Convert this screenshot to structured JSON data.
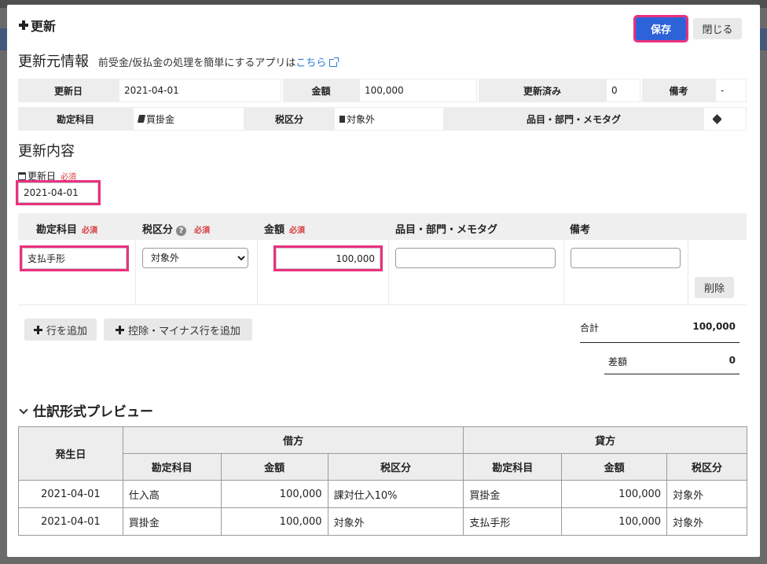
{
  "modal": {
    "title": "更新"
  },
  "header": {
    "save_label": "保存",
    "close_label": "閉じる"
  },
  "source_info": {
    "heading": "更新元情報",
    "note": "前受金/仮払金の処理を簡単にするアプリは",
    "link_label": "こちら",
    "row1": {
      "date_label": "更新日",
      "date_value": "2021-04-01",
      "amount_label": "金額",
      "amount_value": "100,000",
      "updated_label": "更新済み",
      "updated_value": "0",
      "remarks_label": "備考",
      "remarks_value": "-"
    },
    "row2": {
      "account_label": "勘定科目",
      "account_value": "買掛金",
      "tax_label": "税区分",
      "tax_value": "対象外",
      "tags_label": "品目・部門・メモタグ"
    }
  },
  "update_content": {
    "heading": "更新内容",
    "date_label": "更新日",
    "required": "必須",
    "date_value": "2021-04-01",
    "columns": {
      "account": "勘定科目",
      "tax": "税区分",
      "amount": "金額",
      "tags": "品目・部門・メモタグ",
      "remarks": "備考"
    },
    "help_icon": "?",
    "row": {
      "account": "支払手形",
      "tax_selected": "対象外",
      "amount": "100,000",
      "tags": "",
      "remarks": "",
      "delete_label": "削除"
    },
    "add_row_label": "行を追加",
    "add_minus_row_label": "控除・マイナス行を追加",
    "total_label": "合計",
    "total_value": "100,000",
    "diff_label": "差額",
    "diff_value": "0"
  },
  "preview": {
    "heading": "仕訳形式プレビュー",
    "date_header": "発生日",
    "debit_header": "借方",
    "credit_header": "貸方",
    "sub_headers": {
      "account": "勘定科目",
      "amount": "金額",
      "tax": "税区分"
    },
    "rows": [
      {
        "date": "2021-04-01",
        "debit_account": "仕入高",
        "debit_amount": "100,000",
        "debit_tax": "課対仕入10%",
        "credit_account": "買掛金",
        "credit_amount": "100,000",
        "credit_tax": "対象外"
      },
      {
        "date": "2021-04-01",
        "debit_account": "買掛金",
        "debit_amount": "100,000",
        "debit_tax": "対象外",
        "credit_account": "支払手形",
        "credit_amount": "100,000",
        "credit_tax": "対象外"
      }
    ]
  },
  "colors": {
    "accent": "#2d62d8",
    "highlight": "#e9317e",
    "required": "#d9393e",
    "link": "#2a7ad6"
  }
}
